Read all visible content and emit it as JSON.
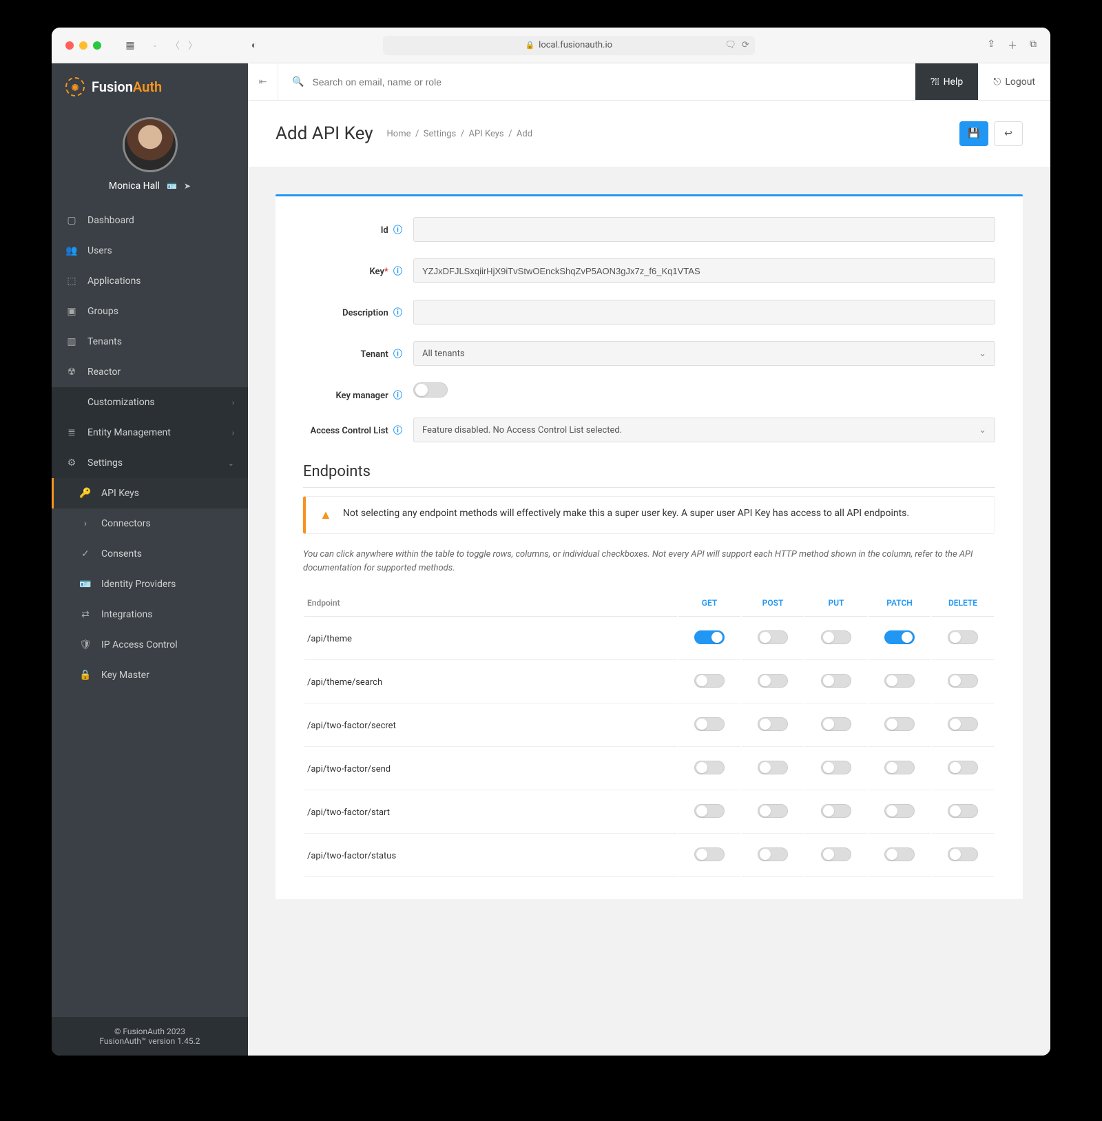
{
  "browser": {
    "url": "local.fusionauth.io"
  },
  "brand": {
    "name_a": "Fusion",
    "name_b": "Auth"
  },
  "user": {
    "name": "Monica Hall"
  },
  "topbar": {
    "search_placeholder": "Search on email, name or role",
    "help": "Help",
    "logout": "Logout"
  },
  "sidebar": {
    "items": [
      {
        "label": "Dashboard",
        "icon": "▢"
      },
      {
        "label": "Users",
        "icon": "👥"
      },
      {
        "label": "Applications",
        "icon": "⬚"
      },
      {
        "label": "Groups",
        "icon": "▣"
      },
      {
        "label": "Tenants",
        "icon": "▥"
      },
      {
        "label": "Reactor",
        "icon": "☢"
      }
    ],
    "sections": [
      {
        "label": "Customizations",
        "icon": "</>"
      },
      {
        "label": "Entity Management",
        "icon": "≣"
      },
      {
        "label": "Settings",
        "icon": "⚙",
        "expanded": true
      }
    ],
    "settings_sub": [
      {
        "label": "API Keys",
        "icon": "🔑",
        "active": true
      },
      {
        "label": "Connectors",
        "icon": "›"
      },
      {
        "label": "Consents",
        "icon": "✓"
      },
      {
        "label": "Identity Providers",
        "icon": "🪪"
      },
      {
        "label": "Integrations",
        "icon": "⇄"
      },
      {
        "label": "IP Access Control",
        "icon": "🛡"
      },
      {
        "label": "Key Master",
        "icon": "🔒"
      }
    ]
  },
  "footer": {
    "line1": "© FusionAuth 2023",
    "line2": "FusionAuth™ version 1.45.2"
  },
  "page": {
    "title": "Add API Key",
    "breadcrumb": [
      "Home",
      "Settings",
      "API Keys",
      "Add"
    ]
  },
  "form": {
    "labels": {
      "id": "Id",
      "key": "Key",
      "description": "Description",
      "tenant": "Tenant",
      "key_manager": "Key manager",
      "acl": "Access Control List"
    },
    "values": {
      "id": "",
      "key": "YZJxDFJLSxqiirHjX9iTvStwOEnckShqZvP5AON3gJx7z_f6_Kq1VTAS",
      "description": "",
      "tenant": "All tenants",
      "key_manager": false,
      "acl": "Feature disabled. No Access Control List selected."
    }
  },
  "endpoints": {
    "title": "Endpoints",
    "alert": "Not selecting any endpoint methods will effectively make this a super user key. A super user API Key has access to all API endpoints.",
    "hint": "You can click anywhere within the table to toggle rows, columns, or individual checkboxes. Not every API will support each HTTP method shown in the column, refer to the API documentation for supported methods.",
    "columns": [
      "Endpoint",
      "GET",
      "POST",
      "PUT",
      "PATCH",
      "DELETE"
    ],
    "rows": [
      {
        "path": "/api/theme",
        "get": true,
        "post": false,
        "put": false,
        "patch": true,
        "delete": false
      },
      {
        "path": "/api/theme/search",
        "get": false,
        "post": false,
        "put": false,
        "patch": false,
        "delete": false
      },
      {
        "path": "/api/two-factor/secret",
        "get": false,
        "post": false,
        "put": false,
        "patch": false,
        "delete": false
      },
      {
        "path": "/api/two-factor/send",
        "get": false,
        "post": false,
        "put": false,
        "patch": false,
        "delete": false
      },
      {
        "path": "/api/two-factor/start",
        "get": false,
        "post": false,
        "put": false,
        "patch": false,
        "delete": false
      },
      {
        "path": "/api/two-factor/status",
        "get": false,
        "post": false,
        "put": false,
        "patch": false,
        "delete": false
      }
    ]
  }
}
